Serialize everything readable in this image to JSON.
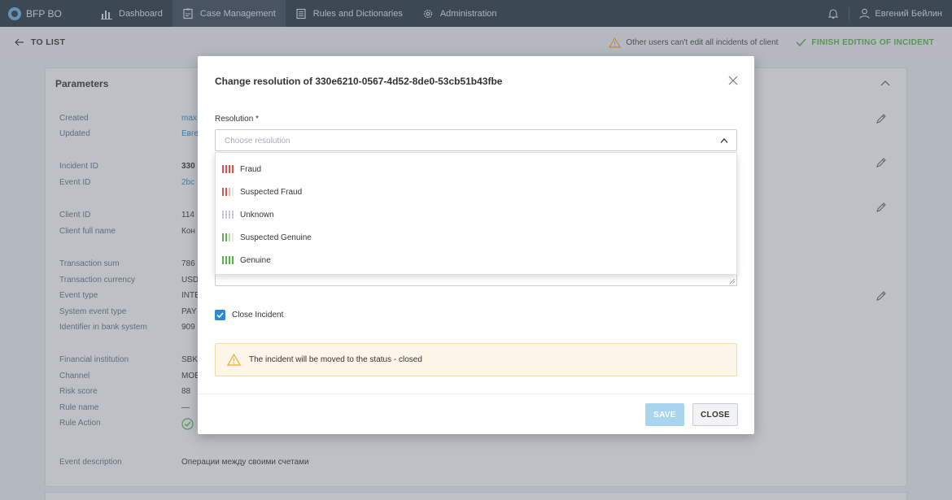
{
  "app": {
    "brand": "BFP BO"
  },
  "nav": {
    "items": [
      {
        "label": "Dashboard",
        "icon": "bar-chart-icon"
      },
      {
        "label": "Case Management",
        "icon": "case-icon"
      },
      {
        "label": "Rules and Dictionaries",
        "icon": "book-icon"
      },
      {
        "label": "Administration",
        "icon": "gear-icon"
      }
    ],
    "active": "Case Management",
    "user": "Евгений Бейлин"
  },
  "subbar": {
    "back_label": "TO LIST",
    "warning": "Other users can't edit all incidents of client",
    "finish_label": "FINISH EDITING OF INCIDENT"
  },
  "card": {
    "title": "Parameters",
    "fields": [
      {
        "label": "Created",
        "value": "max"
      },
      {
        "label": "Updated",
        "value": "Евге"
      },
      {
        "label": "Incident ID",
        "value": "330"
      },
      {
        "label": "Event ID",
        "value": "2bc"
      },
      {
        "label": "Client ID",
        "value": "114"
      },
      {
        "label": "Client full name",
        "value": "Кон"
      },
      {
        "label": "Transaction sum",
        "value": "786"
      },
      {
        "label": "Transaction currency",
        "value": "USD"
      },
      {
        "label": "Event type",
        "value": "INTE"
      },
      {
        "label": "System event type",
        "value": "PAY"
      },
      {
        "label": "Identifier in bank system",
        "value": "909"
      },
      {
        "label": "Financial institution",
        "value": "SBK"
      },
      {
        "label": "Channel",
        "value": "MOE"
      },
      {
        "label": "Risk score",
        "value": "88"
      },
      {
        "label": "Rule name",
        "value": "—"
      },
      {
        "label": "Rule Action",
        "value": ""
      },
      {
        "label": "Event description",
        "value": "Операции между своими счетами"
      }
    ]
  },
  "modal": {
    "title": "Change resolution of 330e6210-0567-4d52-8de0-53cb51b43fbe",
    "resolution_label": "Resolution *",
    "resolution_placeholder": "Choose resolution",
    "options": [
      {
        "label": "Fraud",
        "colors": [
          "#e0524f",
          "#e0524f",
          "#e0524f",
          "#e0524f"
        ]
      },
      {
        "label": "Suspected Fraud",
        "colors": [
          "#e0524f",
          "#e0524f",
          "#f3b1b0",
          "#e6e7e9"
        ]
      },
      {
        "label": "Unknown",
        "colors": [
          "#c9ccd0",
          "#c9ccd0",
          "#c9ccd0",
          "#c9ccd0"
        ]
      },
      {
        "label": "Suspected Genuine",
        "colors": [
          "#5ab34a",
          "#5ab34a",
          "#b6dcae",
          "#e6e7e9"
        ]
      },
      {
        "label": "Genuine",
        "colors": [
          "#5ab34a",
          "#5ab34a",
          "#5ab34a",
          "#5ab34a"
        ]
      }
    ],
    "close_incident_label": "Close Incident",
    "close_incident_checked": true,
    "alert_text": "The incident will be moved to the status - closed",
    "save_label": "SAVE",
    "close_label": "CLOSE"
  },
  "colors": {
    "accent": "#2b8ad6",
    "success": "#5ab34a",
    "warning": "#f0a92a"
  }
}
